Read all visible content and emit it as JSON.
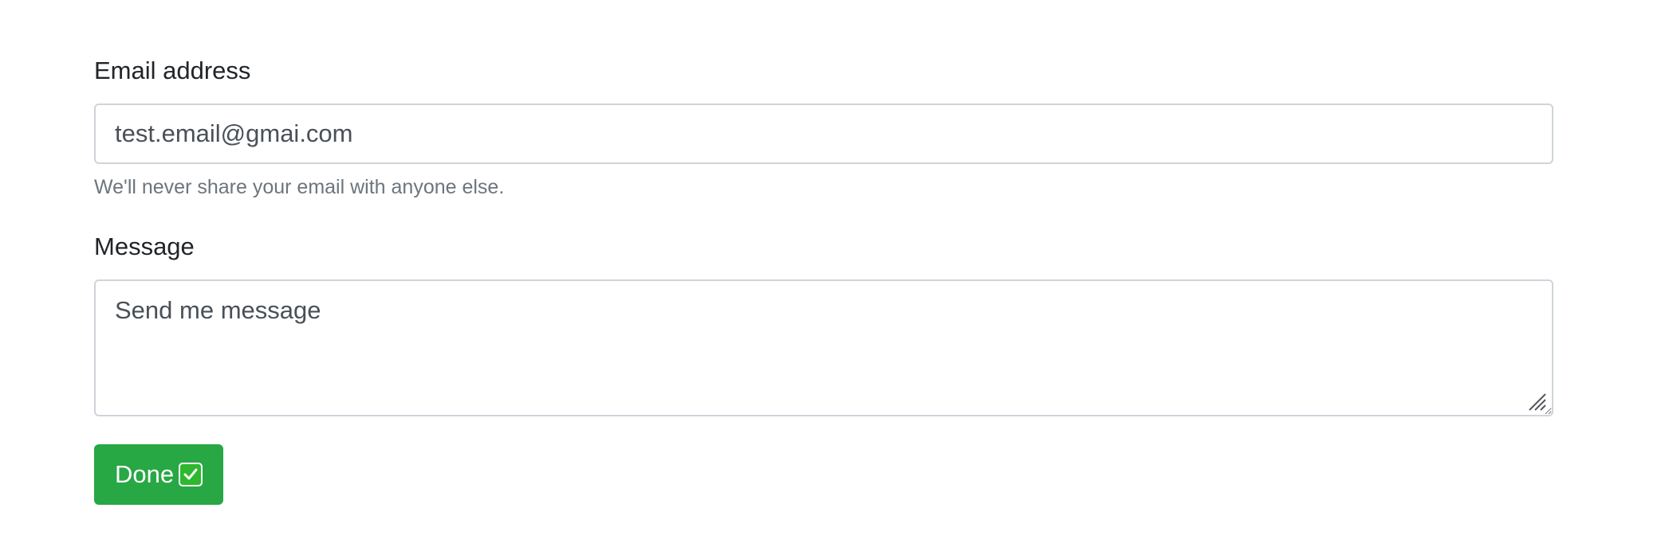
{
  "form": {
    "email": {
      "label": "Email address",
      "value": "test.email@gmai.com",
      "help": "We'll never share your email with anyone else."
    },
    "message": {
      "label": "Message",
      "value": "Send me message"
    },
    "submit": {
      "label": "Done",
      "icon": "check-mark-button-icon"
    }
  },
  "colors": {
    "primary_button": "#28a745",
    "input_border": "#ced4da",
    "help_text": "#6c757d",
    "label_text": "#212529",
    "input_text": "#495057"
  }
}
